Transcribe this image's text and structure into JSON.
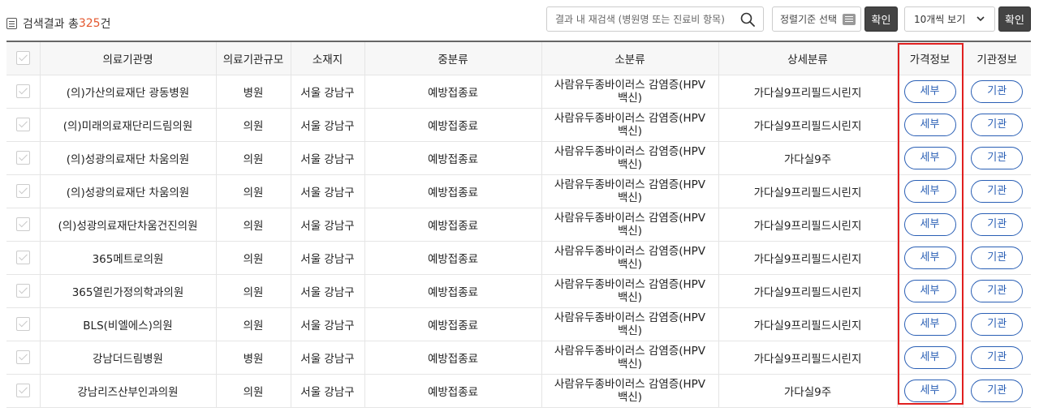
{
  "topbar": {
    "count_prefix": "검색결과 총",
    "count_value": "325",
    "count_suffix": "건",
    "search_placeholder": "결과 내 재검색 (병원명 또는 진료비 항목)",
    "sort_label": "정렬기준 선택",
    "confirm_label_1": "확인",
    "page_size_label": "10개씩 보기",
    "confirm_label_2": "확인"
  },
  "table": {
    "headers": {
      "name": "의료기관명",
      "size": "의료기관규모",
      "location": "소재지",
      "mid_category": "중분류",
      "sub_category": "소분류",
      "detail_category": "상세분류",
      "price_info": "가격정보",
      "facility_info": "기관정보"
    },
    "rows": [
      {
        "name": "(의)가산의료재단 광동병원",
        "size": "병원",
        "location": "서울 강남구",
        "mid": "예방접종료",
        "sub1": "사람유두종바이러스 감염증(HPV",
        "sub2": "백신)",
        "detail": "가다실9프리필드시린지",
        "price_btn": "세부",
        "facility_btn": "기관"
      },
      {
        "name": "(의)미래의료재단리드림의원",
        "size": "의원",
        "location": "서울 강남구",
        "mid": "예방접종료",
        "sub1": "사람유두종바이러스 감염증(HPV",
        "sub2": "백신)",
        "detail": "가다실9프리필드시린지",
        "price_btn": "세부",
        "facility_btn": "기관"
      },
      {
        "name": "(의)성광의료재단 차움의원",
        "size": "의원",
        "location": "서울 강남구",
        "mid": "예방접종료",
        "sub1": "사람유두종바이러스 감염증(HPV",
        "sub2": "백신)",
        "detail": "가다실9주",
        "price_btn": "세부",
        "facility_btn": "기관"
      },
      {
        "name": "(의)성광의료재단 차움의원",
        "size": "의원",
        "location": "서울 강남구",
        "mid": "예방접종료",
        "sub1": "사람유두종바이러스 감염증(HPV",
        "sub2": "백신)",
        "detail": "가다실9프리필드시린지",
        "price_btn": "세부",
        "facility_btn": "기관"
      },
      {
        "name": "(의)성광의료재단차움건진의원",
        "size": "의원",
        "location": "서울 강남구",
        "mid": "예방접종료",
        "sub1": "사람유두종바이러스 감염증(HPV",
        "sub2": "백신)",
        "detail": "가다실9프리필드시린지",
        "price_btn": "세부",
        "facility_btn": "기관"
      },
      {
        "name": "365메트로의원",
        "size": "의원",
        "location": "서울 강남구",
        "mid": "예방접종료",
        "sub1": "사람유두종바이러스 감염증(HPV",
        "sub2": "백신)",
        "detail": "가다실9프리필드시린지",
        "price_btn": "세부",
        "facility_btn": "기관"
      },
      {
        "name": "365열린가정의학과의원",
        "size": "의원",
        "location": "서울 강남구",
        "mid": "예방접종료",
        "sub1": "사람유두종바이러스 감염증(HPV",
        "sub2": "백신)",
        "detail": "가다실9프리필드시린지",
        "price_btn": "세부",
        "facility_btn": "기관"
      },
      {
        "name": "BLS(비엘에스)의원",
        "size": "의원",
        "location": "서울 강남구",
        "mid": "예방접종료",
        "sub1": "사람유두종바이러스 감염증(HPV",
        "sub2": "백신)",
        "detail": "가다실9프리필드시린지",
        "price_btn": "세부",
        "facility_btn": "기관"
      },
      {
        "name": "강남더드림병원",
        "size": "병원",
        "location": "서울 강남구",
        "mid": "예방접종료",
        "sub1": "사람유두종바이러스 감염증(HPV",
        "sub2": "백신)",
        "detail": "가다실9프리필드시린지",
        "price_btn": "세부",
        "facility_btn": "기관"
      },
      {
        "name": "강남리즈산부인과의원",
        "size": "의원",
        "location": "서울 강남구",
        "mid": "예방접종료",
        "sub1": "사람유두종바이러스 감염증(HPV",
        "sub2": "백신)",
        "detail": "가다실9주",
        "price_btn": "세부",
        "facility_btn": "기관"
      }
    ]
  },
  "colors": {
    "accent_blue": "#2a5fb5",
    "highlight_red": "#e02020",
    "count_orange": "#e4572e",
    "dark_button": "#444444"
  }
}
